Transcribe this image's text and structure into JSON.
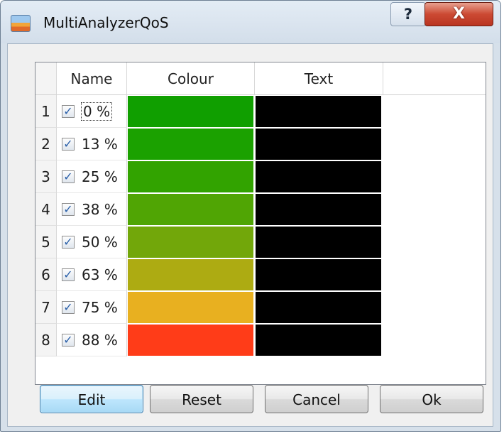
{
  "window": {
    "title": "MultiAnalyzerQoS",
    "help_label": "?",
    "close_label": "X"
  },
  "table": {
    "columns": [
      "Name",
      "Colour",
      "Text"
    ],
    "rows": [
      {
        "num": "1",
        "checked": true,
        "name": "0 %",
        "colour": "#109f00",
        "text_colour": "#000000"
      },
      {
        "num": "2",
        "checked": true,
        "name": "13 %",
        "colour": "#1ba100",
        "text_colour": "#000000"
      },
      {
        "num": "3",
        "checked": true,
        "name": "25 %",
        "colour": "#32a300",
        "text_colour": "#000000"
      },
      {
        "num": "4",
        "checked": true,
        "name": "38 %",
        "colour": "#50a504",
        "text_colour": "#000000"
      },
      {
        "num": "5",
        "checked": true,
        "name": "50 %",
        "colour": "#72a70a",
        "text_colour": "#000000"
      },
      {
        "num": "6",
        "checked": true,
        "name": "63 %",
        "colour": "#adab12",
        "text_colour": "#000000"
      },
      {
        "num": "7",
        "checked": true,
        "name": "75 %",
        "colour": "#e8b020",
        "text_colour": "#000000"
      },
      {
        "num": "8",
        "checked": true,
        "name": "88 %",
        "colour": "#ff3c18",
        "text_colour": "#000000"
      }
    ]
  },
  "buttons": {
    "edit": "Edit",
    "reset": "Reset",
    "cancel": "Cancel",
    "ok": "Ok"
  }
}
